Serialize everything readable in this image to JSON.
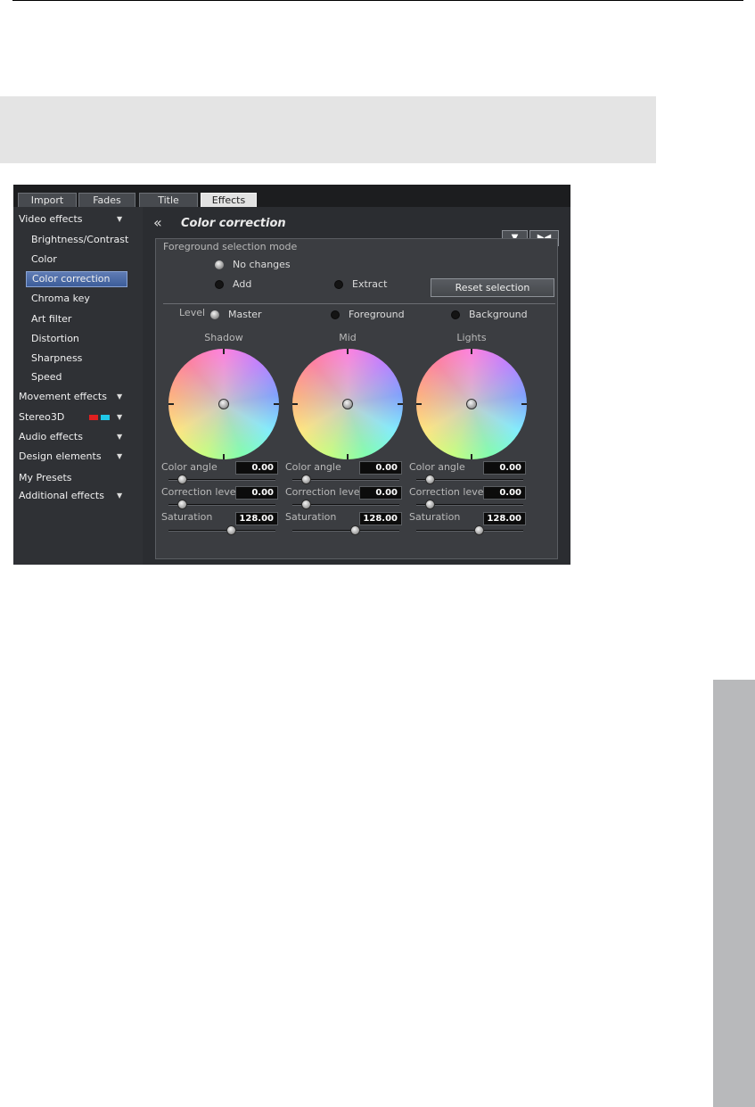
{
  "tabs": [
    "Import",
    "Fades",
    "Title",
    "Effects"
  ],
  "sidebar": {
    "video_group": "Video effects",
    "video_items": [
      "Brightness/Contrast",
      "Color",
      "Color correction",
      "Chroma key",
      "Art filter",
      "Distortion",
      "Sharpness",
      "Speed"
    ],
    "selected_item": "Color correction",
    "groups": {
      "movement": "Movement effects",
      "stereo": "Stereo3D",
      "audio": "Audio effects",
      "design": "Design elements",
      "presets": "My Presets",
      "additional": "Additional effects"
    }
  },
  "panel": {
    "back_icon": "double-chevron-left-icon",
    "title": "Color correction",
    "header_buttons": [
      "▼",
      "▶◀"
    ],
    "fg_mode_label": "Foreground selection mode",
    "fg_options": {
      "no_changes": "No changes",
      "add": "Add",
      "extract": "Extract"
    },
    "fg_selected": "No changes",
    "reset_label": "Reset selection",
    "level_label": "Level",
    "level_options": {
      "master": "Master",
      "foreground": "Foreground",
      "background": "Background"
    },
    "level_selected": "Master",
    "wheels": [
      {
        "title": "Shadow",
        "angle_label": "Color angle",
        "angle": "0.00",
        "correction_label": "Correction level",
        "correction": "0.00",
        "saturation_label": "Saturation",
        "saturation": "128.00",
        "angle_fraction": 0.0,
        "correction_fraction": 0.0,
        "saturation_fraction": 0.5
      },
      {
        "title": "Mid",
        "angle_label": "Color angle",
        "angle": "0.00",
        "correction_label": "Correction level",
        "correction": "0.00",
        "saturation_label": "Saturation",
        "saturation": "128.00",
        "angle_fraction": 0.0,
        "correction_fraction": 0.0,
        "saturation_fraction": 0.5
      },
      {
        "title": "Lights",
        "angle_label": "Color angle",
        "angle": "0.00",
        "correction_label": "Correction level",
        "correction": "0.00",
        "saturation_label": "Saturation",
        "saturation": "128.00",
        "angle_fraction": 0.0,
        "correction_fraction": 0.0,
        "saturation_fraction": 0.5
      }
    ]
  },
  "colors": {
    "accent_selected": "#4a6aa8",
    "stereo_red": "#e02020",
    "stereo_cyan": "#20c8e8"
  }
}
